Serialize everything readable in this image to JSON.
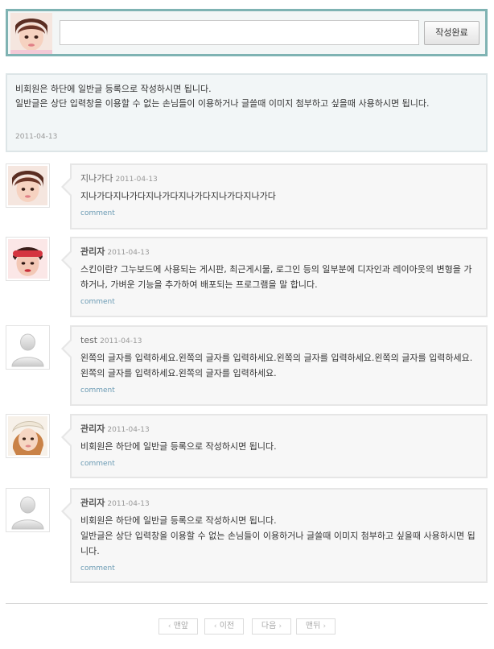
{
  "writebox": {
    "input_value": "",
    "input_placeholder": "",
    "submit_label": "작성완료"
  },
  "notice": {
    "text": "비회원은 하단에 일반글 등록으로 작성하시면 됩니다.\n일반글은 상단 입력창을 이용할 수 없는 손님들이 이용하거나 글쓸때 이미지 첨부하고 싶을때 사용하시면 됩니다.",
    "date": "2011-04-13"
  },
  "comments": [
    {
      "author": "지나가다",
      "date": "2011-04-13",
      "body": "지나가다지나가다지나가다지나가다지나가다지나가다",
      "link": "comment"
    },
    {
      "author": "관리자",
      "date": "2011-04-13",
      "body": "스킨이란? 그누보드에 사용되는 게시판, 최근게시물, 로그인 등의 일부분에 디자인과 레이아웃의 변형을 가하거나, 가벼운 기능을 추가하여 배포되는 프로그램을 말 합니다.",
      "link": "comment"
    },
    {
      "author": "test",
      "date": "2011-04-13",
      "body": "왼쪽의 글자를 입력하세요.왼쪽의 글자를 입력하세요.왼쪽의 글자를 입력하세요.왼쪽의 글자를 입력하세요.왼쪽의 글자를 입력하세요.왼쪽의 글자를 입력하세요.",
      "link": "comment"
    },
    {
      "author": "관리자",
      "date": "2011-04-13",
      "body": "비회원은 하단에 일반글 등록으로 작성하시면 됩니다.",
      "link": "comment"
    },
    {
      "author": "관리자",
      "date": "2011-04-13",
      "body": "비회원은 하단에 일반글 등록으로 작성하시면 됩니다.\n일반글은 상단 입력창을 이용할 수 없는 손님들이 이용하거나 글쓸때 이미지 첨부하고 싶을때 사용하시면 됩니다.",
      "link": "comment"
    }
  ],
  "pager": {
    "first": "맨앞",
    "prev": "이전",
    "next": "다음",
    "last": "맨뒤"
  },
  "colors": {
    "writebox_border": "#7fb3b3",
    "link": "#6a9ab3",
    "bubble_bg": "#f7f7f7"
  }
}
